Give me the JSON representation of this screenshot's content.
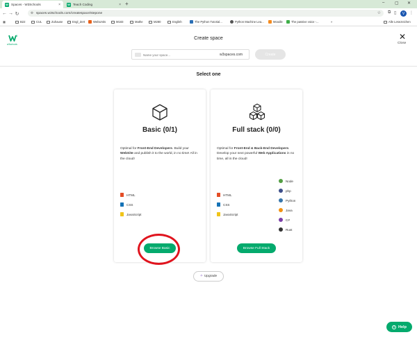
{
  "browser": {
    "tabs": [
      {
        "title": "Spaces - W3Schools",
        "active": true
      },
      {
        "title": "Teach Coding",
        "active": false
      }
    ],
    "url": "spaces.w3schools.com/createspace/stepone",
    "bookmarks": [
      "B22",
      "CUL",
      "Zuhause",
      "Engl_Zert",
      "WebUntis",
      "M183",
      "Mathe",
      "M280",
      "English",
      "The Python Tutorial...",
      "Python Machine Lea...",
      "Moodle",
      "The passive voice -..."
    ],
    "all_bookmarks": "Alle Lesezeichen",
    "profile_initial": "V"
  },
  "header": {
    "logo_sub": "w3schools",
    "title": "Create space",
    "close_label": "Close"
  },
  "create_form": {
    "placeholder": "Name your space...",
    "domain_suffix": "w3spaces.com",
    "create_label": "Create"
  },
  "select_label": "Select one",
  "cards": {
    "basic": {
      "title": "Basic (0/1)",
      "desc_pre": "Optimal for ",
      "desc_bold1": "Front-End Developers",
      "desc_mid": ". Build your ",
      "desc_bold2": "WebSite",
      "desc_post": " and publish it to the world, in no time! All in the cloud!",
      "languages": [
        "HTML",
        "CSS",
        "JavaScript"
      ],
      "button": "Browse Basic"
    },
    "fullstack": {
      "title": "Full stack (0/0)",
      "desc_pre": "Optimal for ",
      "desc_bold1": "Front-End & Back-End Developers",
      "desc_mid": ". Develop your next powerful ",
      "desc_bold2": "Web Applications",
      "desc_post": " in no time, all in the cloud!",
      "languages": [
        "HTML",
        "CSS",
        "JavaScript"
      ],
      "backends": [
        "Node",
        "php",
        "Python",
        "Java",
        "C#",
        "Rust"
      ],
      "button": "Browse Full Stack"
    }
  },
  "upgrade_label": "Upgrade",
  "help_label": "Help",
  "colors": {
    "brand_green": "#04aa6d",
    "annotation_red": "#e0141e"
  }
}
